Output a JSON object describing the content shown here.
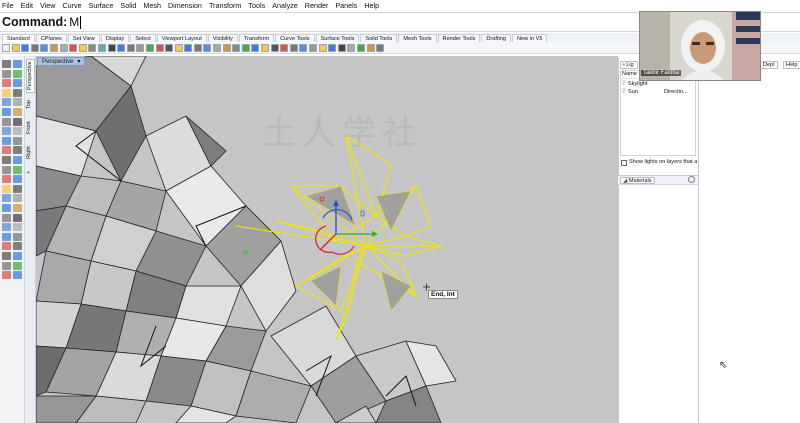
{
  "menu": [
    "File",
    "Edit",
    "View",
    "Curve",
    "Surface",
    "Solid",
    "Mesh",
    "Dimension",
    "Transform",
    "Tools",
    "Analyze",
    "Render",
    "Panels",
    "Help"
  ],
  "command": {
    "label": "Command:",
    "value": "M"
  },
  "toolbar_tabs": [
    "Standard",
    "CPlanes",
    "Set View",
    "Display",
    "Select",
    "Viewport Layout",
    "Visibility",
    "Transform",
    "Curve Tools",
    "Surface Tools",
    "Solid Tools",
    "Mesh Tools",
    "Render Tools",
    "Drafting",
    "New in V5"
  ],
  "viewport_tabs": [
    "Perspective",
    "Top",
    "Front",
    "Right"
  ],
  "viewport": {
    "title": "Perspective",
    "watermark": "土人学社",
    "osnap_label": "End, Int"
  },
  "lights_panel": {
    "tab_label": "Lig",
    "col_name": "Name",
    "rows": [
      {
        "name": "Skylight",
        "type": ""
      },
      {
        "name": "Sun",
        "type": "Directio..."
      }
    ],
    "checkbox_label": "Show lights on layers that a"
  },
  "materials_panel": {
    "tab_label": "Materials"
  },
  "right_tabs": [
    "Depl",
    "Help"
  ],
  "video": {
    "name": "Takbir Fatima"
  },
  "colors": {
    "viewport_bg": "#c5c5c5",
    "selection": "#f2e600",
    "accent": "#a9c3e3"
  }
}
